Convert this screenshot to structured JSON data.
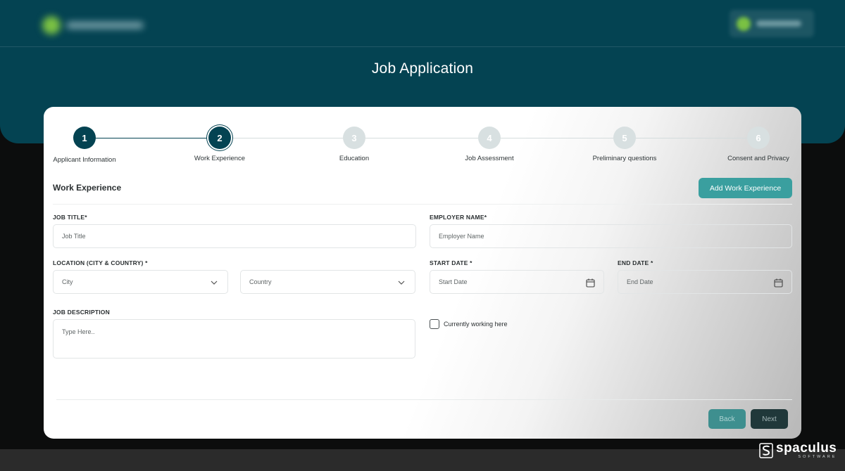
{
  "header": {
    "title": "Job Application"
  },
  "stepper": {
    "steps": [
      {
        "number": "1",
        "label": "Applicant Information",
        "state": "done"
      },
      {
        "number": "2",
        "label": "Work Experience",
        "state": "current"
      },
      {
        "number": "3",
        "label": "Education",
        "state": "upcoming"
      },
      {
        "number": "4",
        "label": "Job Assessment",
        "state": "upcoming"
      },
      {
        "number": "5",
        "label": "Preliminary questions",
        "state": "upcoming"
      },
      {
        "number": "6",
        "label": "Consent and Privacy",
        "state": "upcoming"
      }
    ]
  },
  "form": {
    "section_title": "Work Experience",
    "add_button_label": "Add Work Experience",
    "job_title": {
      "label": "JOB TITLE*",
      "placeholder": "Job Title"
    },
    "employer_name": {
      "label": "EMPLOYER NAME*",
      "placeholder": "Employer Name"
    },
    "location": {
      "label": "LOCATION (CITY & COUNTRY) *",
      "city_placeholder": "City",
      "country_placeholder": "Country"
    },
    "start_date": {
      "label": "START DATE *",
      "placeholder": "Start Date"
    },
    "end_date": {
      "label": "END DATE *",
      "placeholder": "End Date"
    },
    "job_description": {
      "label": "JOB DESCRIPTION",
      "placeholder": "Type Here.."
    },
    "currently_working_label": "Currently working here",
    "back_label": "Back",
    "next_label": "Next"
  },
  "brand": {
    "name": "spaculus",
    "subtitle": "SOFTWARE"
  },
  "colors": {
    "header_bg": "#044352",
    "accent": "#3a9f9f",
    "step_active": "#044352"
  }
}
